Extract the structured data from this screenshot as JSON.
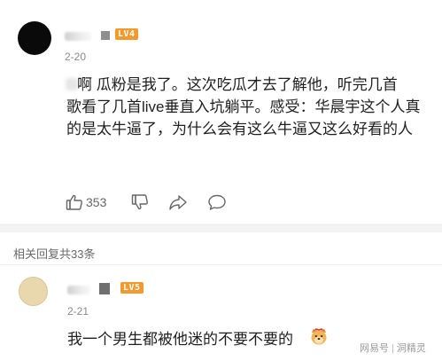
{
  "comments": [
    {
      "level_badge": "LV4",
      "date": "2-20",
      "text_line1": "啊 瓜粉是我了。这次吃瓜才去了解他，听完几首",
      "text_rest": "歌看了几首live垂直入坑躺平。感受：华晨宇这个人真的是太牛逼了，为什么会有这么牛逼又这么好看的人",
      "like_count": "353",
      "icons": [
        "thumbs-up-icon",
        "thumbs-down-icon",
        "share-icon",
        "comment-icon"
      ]
    },
    {
      "level_badge": "LV5",
      "date": "2-21",
      "text": "我一个男生都被他迷的不要不要的",
      "emoji": "dog-face-emoji"
    }
  ],
  "reply_summary": "相关回复共33条",
  "watermark": {
    "left": "网易号",
    "right": "洞精灵"
  },
  "colors": {
    "badge": "#f39a2e",
    "meta": "#8a8a8a",
    "text": "#1f1f1f",
    "divider": "#f3f3f3"
  }
}
